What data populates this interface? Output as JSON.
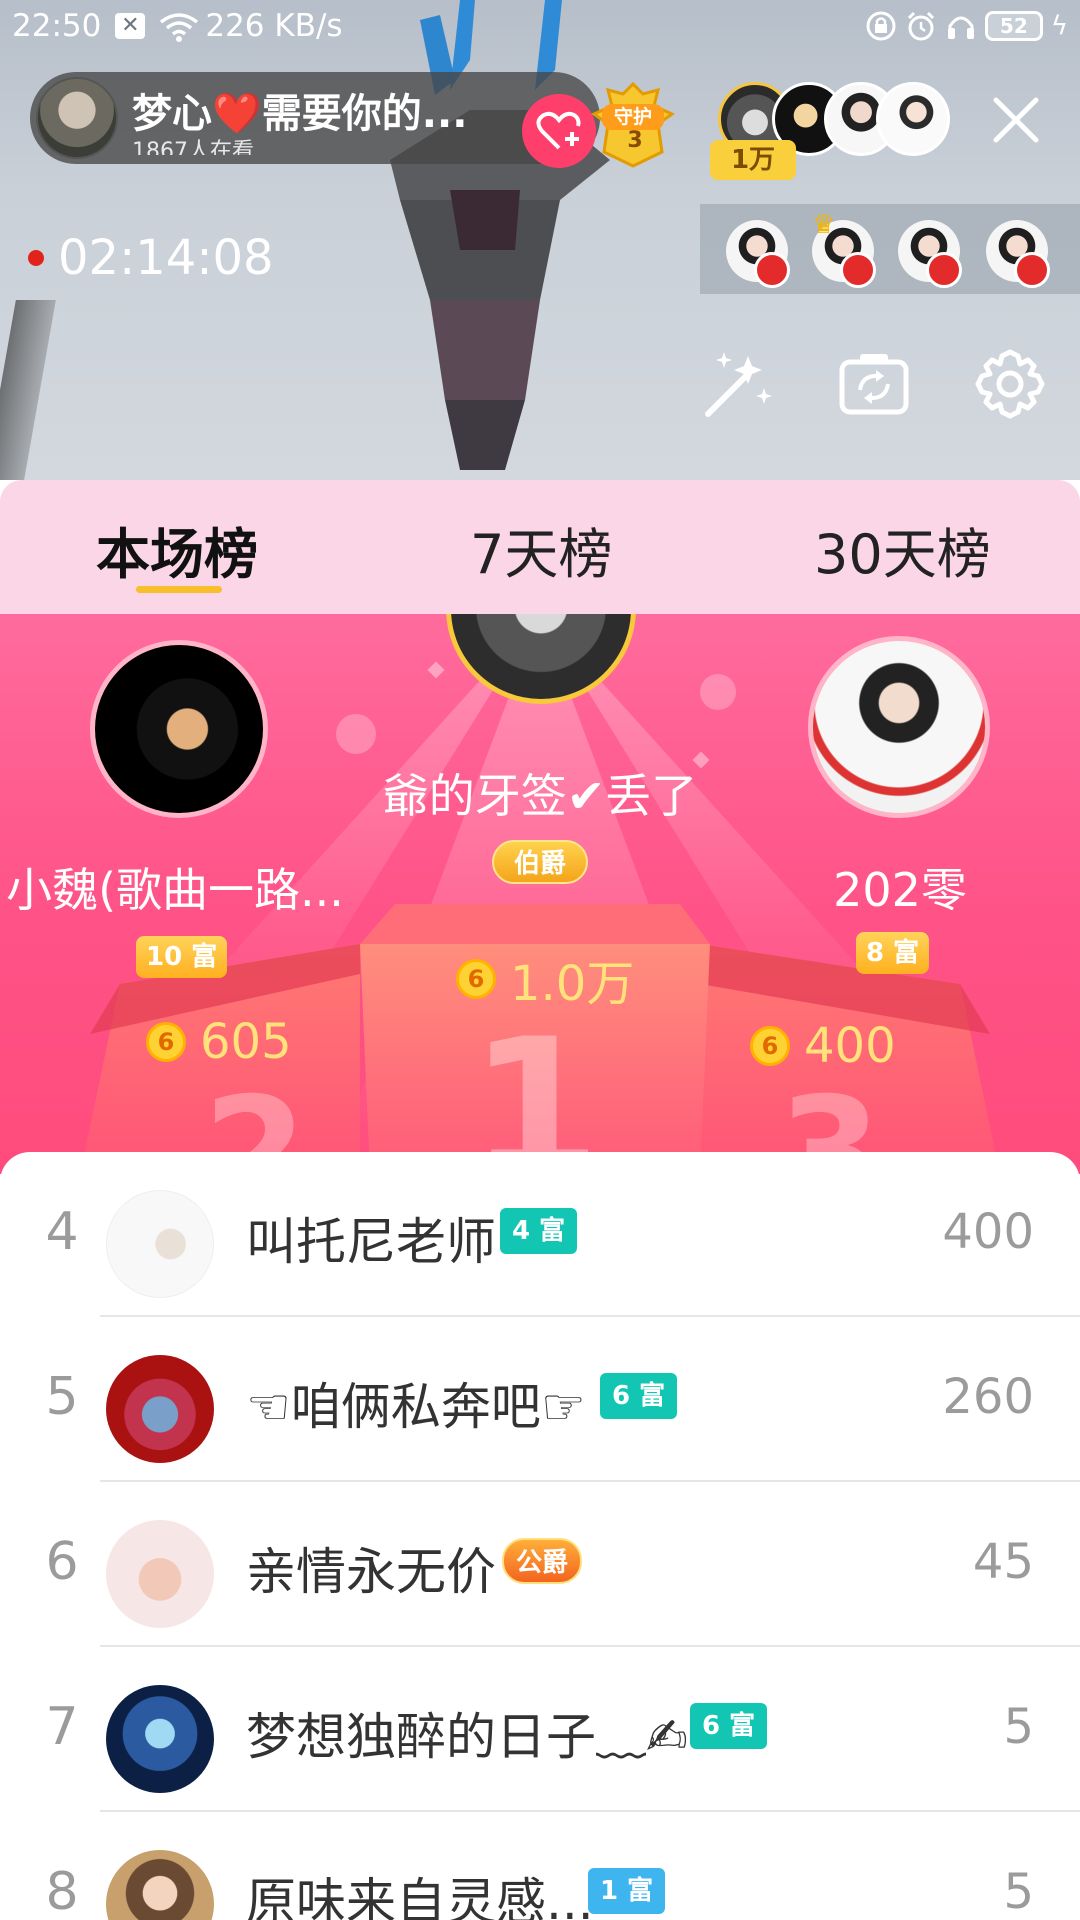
{
  "status_bar": {
    "time": "22:50",
    "notice_icon": "x-box-icon",
    "speed": "226 KB/s",
    "battery": "52"
  },
  "host": {
    "name": "梦心❤️需要你的...",
    "viewers": "1867人在看",
    "guard_label": "守护",
    "guard_count": "3"
  },
  "viewers_top_badge": "1万",
  "recording": {
    "elapsed": "02:14:08"
  },
  "tabs": [
    {
      "label": "本场榜",
      "active": true
    },
    {
      "label": "7天榜",
      "active": false
    },
    {
      "label": "30天榜",
      "active": false
    }
  ],
  "podium": {
    "first": {
      "name": "爺的牙签✔丢了",
      "badge": "伯爵",
      "coins": "1.0万"
    },
    "second": {
      "name": "小魏(歌曲一路...",
      "rich": "10 富",
      "coins": "605"
    },
    "third": {
      "name": "202零",
      "rich": "8 富",
      "coins": "400"
    },
    "coin_glyph": "6"
  },
  "list": [
    {
      "rank": "4",
      "name": "叫托尼老师",
      "level": "4 富",
      "level_style": "teal",
      "score": "400"
    },
    {
      "rank": "5",
      "name": "☜咱俩私奔吧☞",
      "level": "6 富",
      "level_style": "teal",
      "score": "260"
    },
    {
      "rank": "6",
      "name": "亲情永无价",
      "level": "公爵",
      "level_style": "duke",
      "score": "45"
    },
    {
      "rank": "7",
      "name": "梦想独醉的日子﹏✍",
      "level": "6 富",
      "level_style": "teal",
      "score": "5"
    },
    {
      "rank": "8",
      "name": "原味来自灵感...",
      "level": "1 富",
      "level_style": "blue",
      "score": "5"
    }
  ],
  "colors": {
    "accent_pink": "#ff5287",
    "tab_bg": "#fbd6e6",
    "gold": "#f6bf2b",
    "teal_badge": "#12c6b3"
  }
}
